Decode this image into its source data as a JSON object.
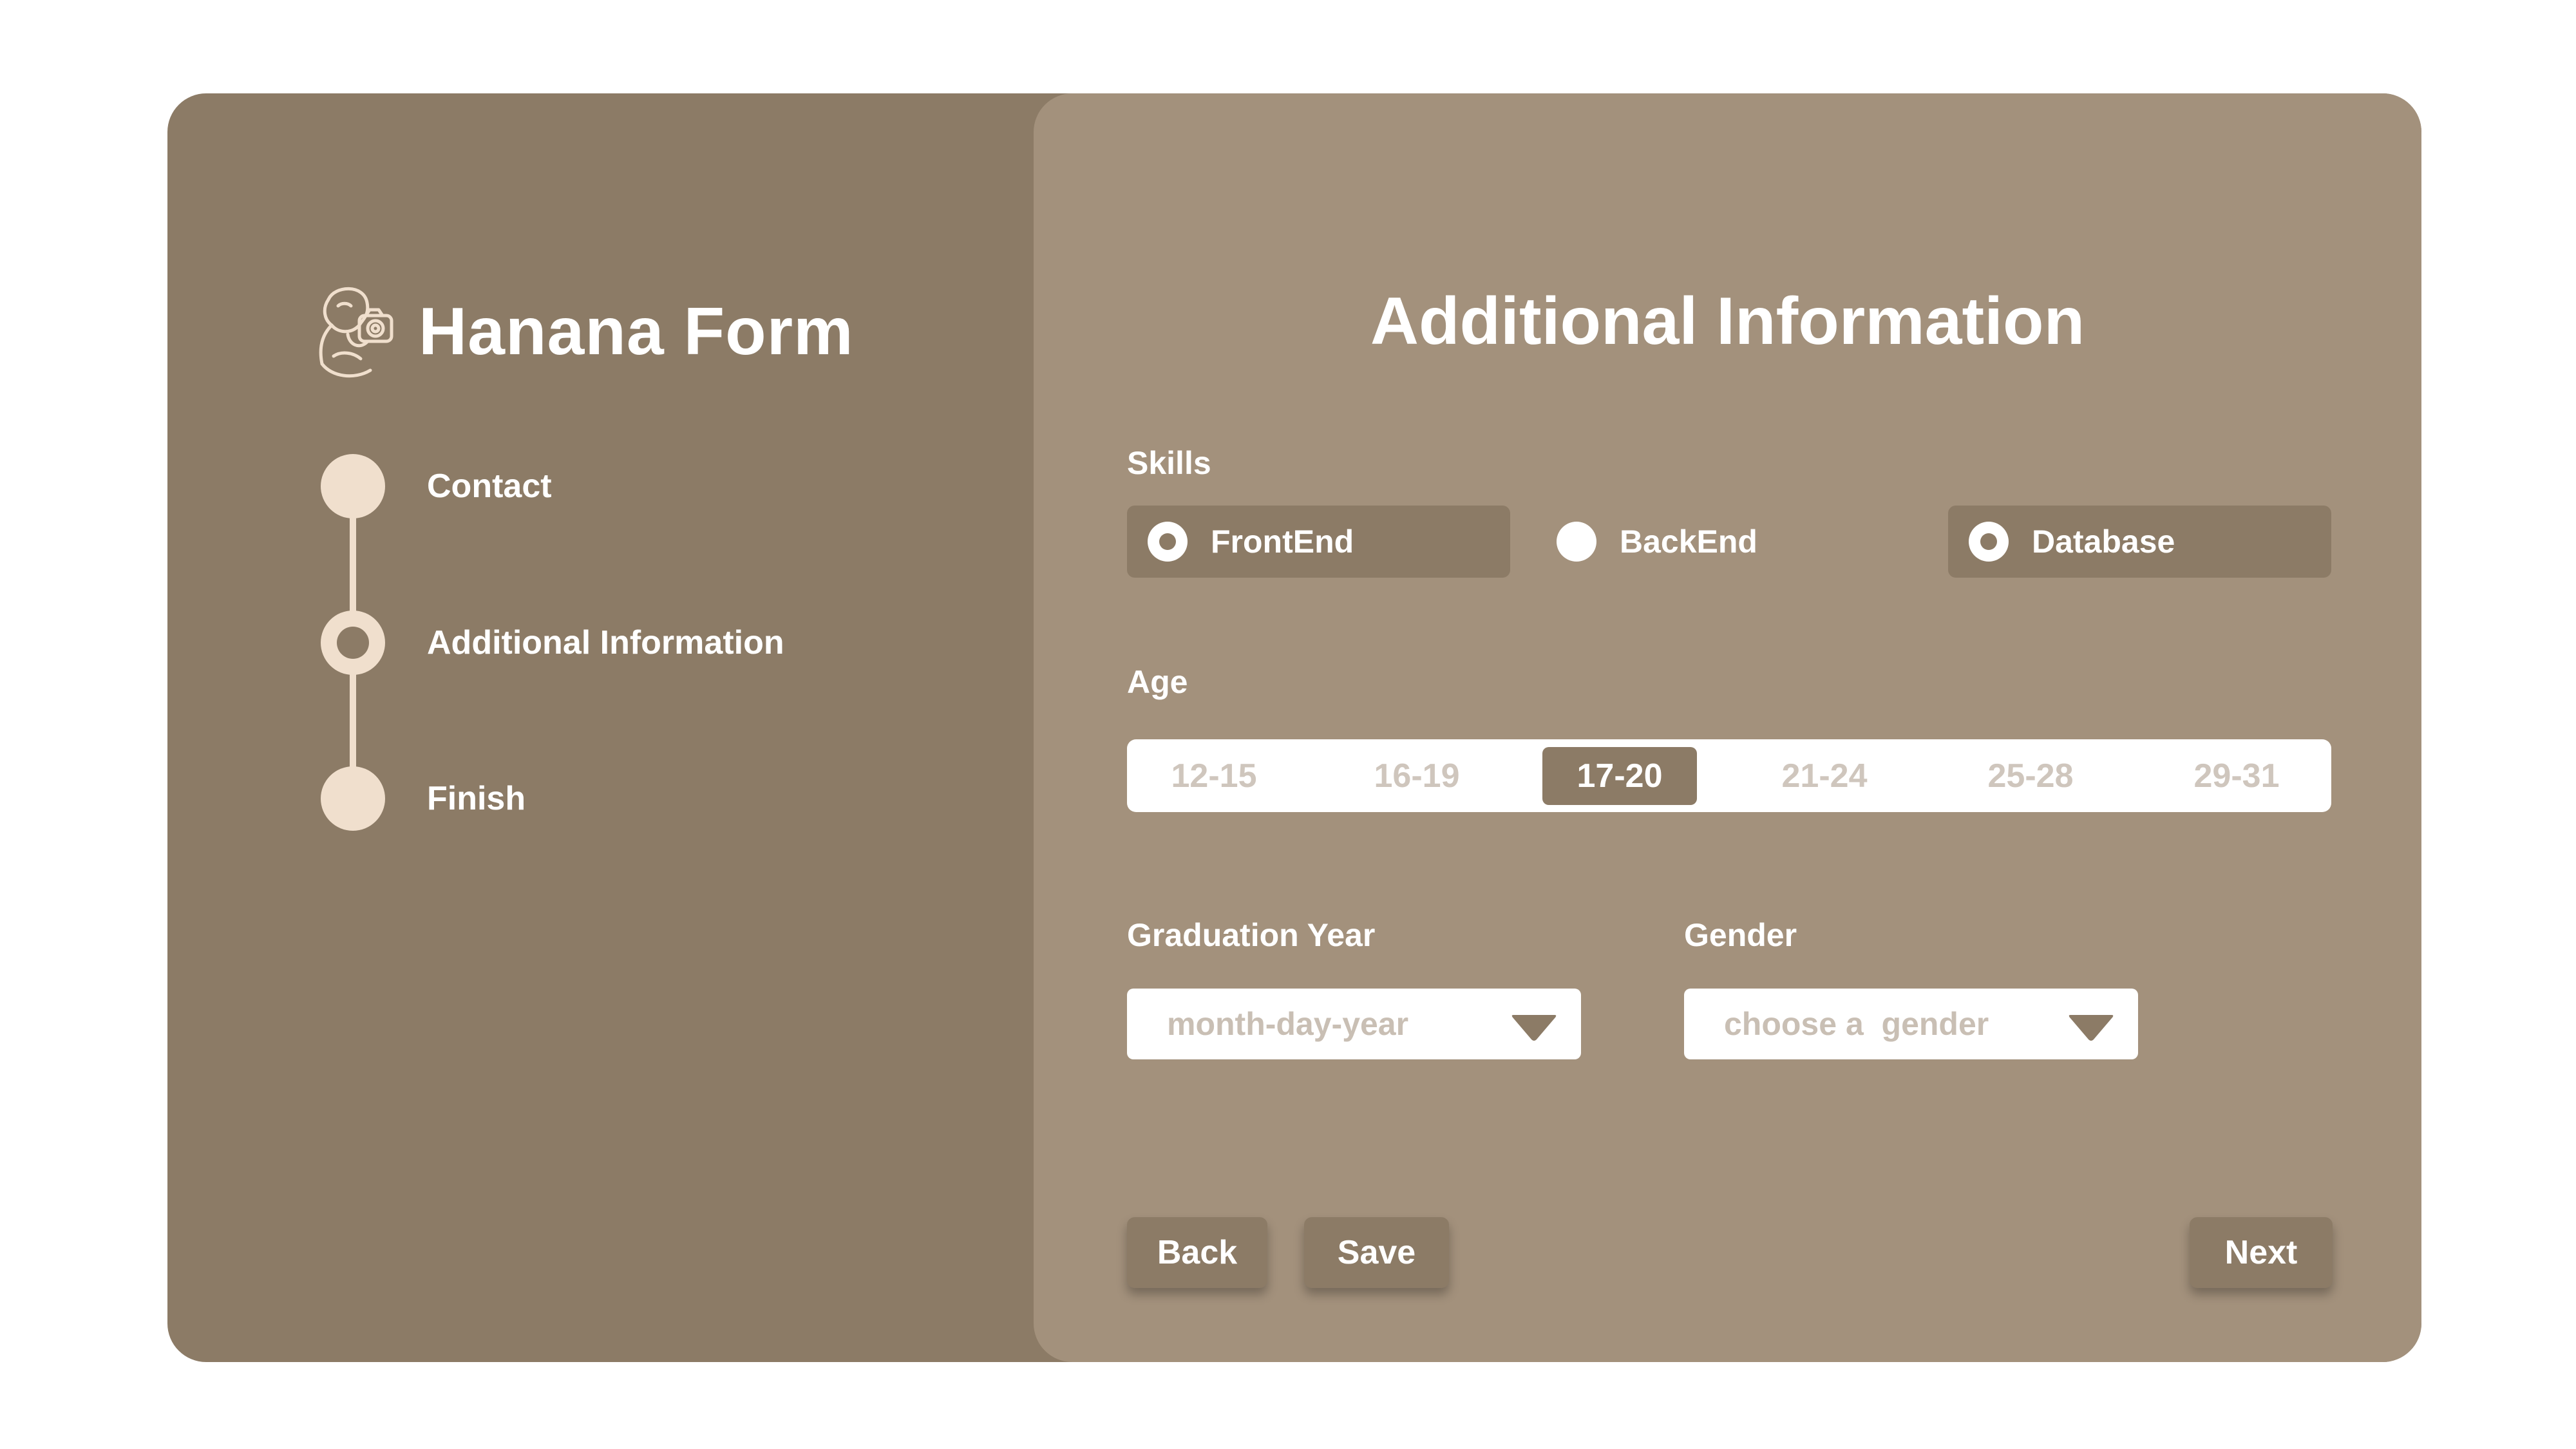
{
  "brand": {
    "title": "Hanana Form",
    "logo_icon": "photographer-logo-icon"
  },
  "steps": [
    {
      "label": "Contact",
      "state": "completed"
    },
    {
      "label": "Additional Information",
      "state": "current"
    },
    {
      "label": "Finish",
      "state": "pending"
    }
  ],
  "form": {
    "title": "Additional Information",
    "skills": {
      "label": "Skills",
      "options": [
        {
          "label": "FrontEnd",
          "checked": true
        },
        {
          "label": "BackEnd",
          "checked": false
        },
        {
          "label": "Database",
          "checked": true
        }
      ]
    },
    "age": {
      "label": "Age",
      "options": [
        "12-15",
        "16-19",
        "17-20",
        "21-24",
        "25-28",
        "29-31"
      ],
      "selected": "17-20"
    },
    "graduation_year": {
      "label": "Graduation Year",
      "placeholder": "month-day-year"
    },
    "gender": {
      "label": "Gender",
      "placeholder": "choose a  gender"
    },
    "buttons": {
      "back": "Back",
      "save": "Save",
      "next": "Next"
    }
  },
  "colors": {
    "panel_dark": "#8c7b66",
    "panel_light": "#a3917c",
    "accent_cream": "#f0dfcd"
  }
}
